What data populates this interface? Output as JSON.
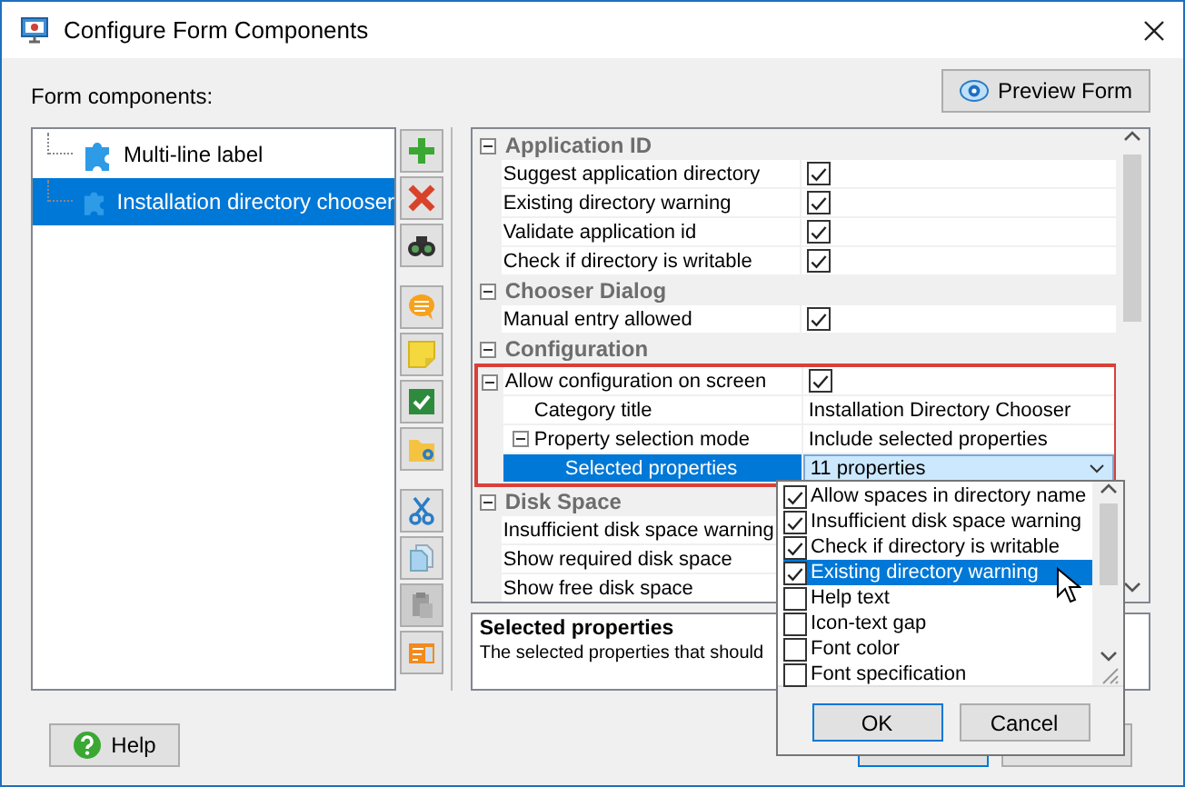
{
  "window": {
    "title": "Configure Form Components"
  },
  "components_label": "Form components:",
  "preview_button": "Preview Form",
  "components": [
    {
      "label": "Multi-line label",
      "selected": false
    },
    {
      "label": "Installation directory chooser",
      "selected": true
    }
  ],
  "toolbar": [
    [
      {
        "kind": "add",
        "disabled": false
      },
      {
        "kind": "remove",
        "disabled": false
      },
      {
        "kind": "find",
        "disabled": false
      }
    ],
    [
      {
        "kind": "comment",
        "disabled": false
      },
      {
        "kind": "note",
        "disabled": false
      },
      {
        "kind": "check",
        "disabled": false
      },
      {
        "kind": "folder",
        "disabled": false
      }
    ],
    [
      {
        "kind": "cut",
        "disabled": false
      },
      {
        "kind": "copy",
        "disabled": false
      },
      {
        "kind": "paste",
        "disabled": true
      },
      {
        "kind": "image",
        "disabled": false
      }
    ]
  ],
  "properties": [
    {
      "category": "Application ID",
      "expanded": true,
      "rows": [
        {
          "name": "Suggest application directory",
          "kind": "checkbox",
          "checked": true,
          "selected": false,
          "highlighted": false
        },
        {
          "name": "Existing directory warning",
          "kind": "checkbox",
          "checked": true,
          "selected": false,
          "highlighted": false
        },
        {
          "name": "Validate application id",
          "kind": "checkbox",
          "checked": true,
          "selected": false,
          "highlighted": false
        },
        {
          "name": "Check if directory is writable",
          "kind": "checkbox",
          "checked": true,
          "selected": false,
          "highlighted": false
        }
      ]
    },
    {
      "category": "Chooser Dialog",
      "expanded": true,
      "rows": [
        {
          "name": "Manual entry allowed",
          "kind": "checkbox",
          "checked": true,
          "selected": false,
          "highlighted": false
        }
      ]
    },
    {
      "category": "Configuration",
      "expanded": true,
      "rows": [
        {
          "name": "Allow configuration on screen",
          "kind": "checkbox",
          "checked": true,
          "selected": false,
          "highlighted": true,
          "expanded": true,
          "children": [
            {
              "name": "Category title",
              "kind": "text",
              "value": "Installation Directory Chooser",
              "selected": false
            },
            {
              "name": "Property selection mode",
              "kind": "text",
              "value": "Include selected properties",
              "selected": false,
              "expanded": true,
              "children": [
                {
                  "name": "Selected properties",
                  "kind": "dropdown",
                  "value": "11 properties",
                  "selected": true
                }
              ]
            }
          ]
        }
      ]
    },
    {
      "category": "Disk Space",
      "expanded": true,
      "rows": [
        {
          "name": "Insufficient disk space warning",
          "kind": "covered",
          "selected": false,
          "highlighted": false
        },
        {
          "name": "Show required disk space",
          "kind": "covered",
          "selected": false,
          "highlighted": false
        },
        {
          "name": "Show free disk space",
          "kind": "covered",
          "selected": false,
          "highlighted": false
        }
      ]
    }
  ],
  "description": {
    "title": "Selected properties",
    "text": "The selected properties that should"
  },
  "help_button": "Help",
  "popup": {
    "items": [
      {
        "label": "Allow spaces in directory name",
        "checked": true,
        "selected": false
      },
      {
        "label": "Insufficient disk space warning",
        "checked": true,
        "selected": false
      },
      {
        "label": "Check if directory is writable",
        "checked": true,
        "selected": false
      },
      {
        "label": "Existing directory warning",
        "checked": true,
        "selected": true
      },
      {
        "label": "Help text",
        "checked": false,
        "selected": false
      },
      {
        "label": "Icon-text gap",
        "checked": false,
        "selected": false
      },
      {
        "label": "Font color",
        "checked": false,
        "selected": false
      },
      {
        "label": "Font specification",
        "checked": false,
        "selected": false
      }
    ],
    "buttons": [
      "OK",
      "Cancel"
    ]
  }
}
